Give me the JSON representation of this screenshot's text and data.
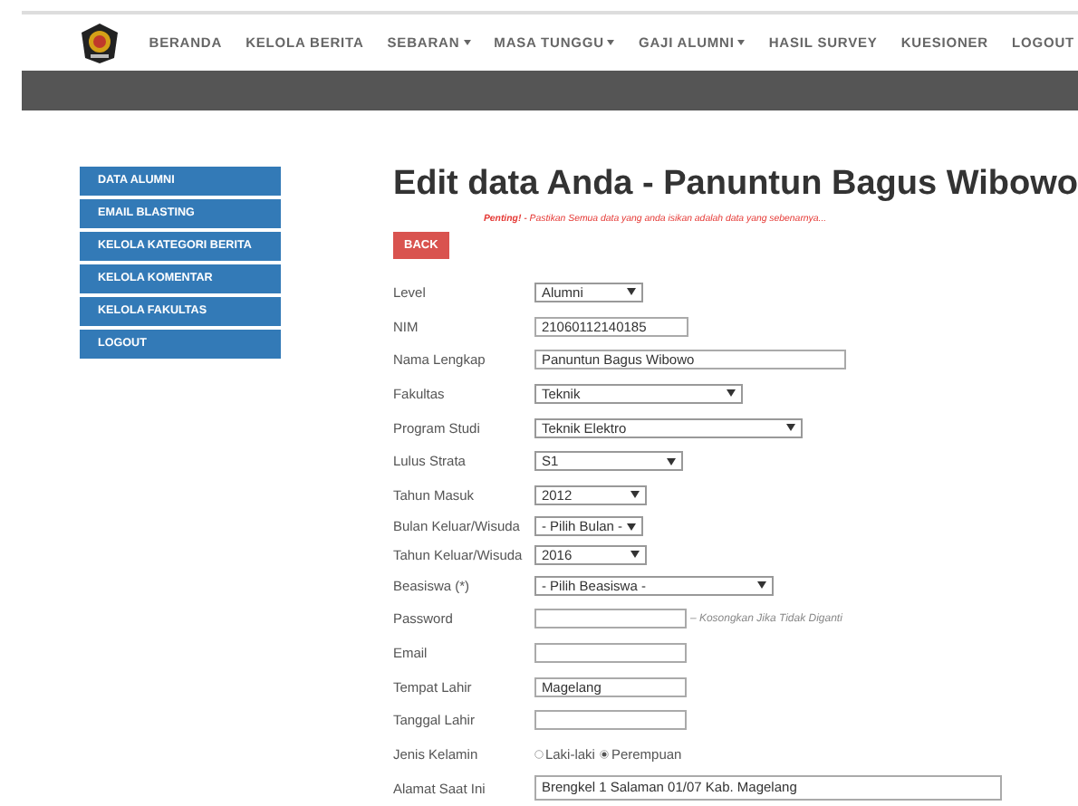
{
  "nav": {
    "items": [
      {
        "label": "BERANDA",
        "dropdown": false
      },
      {
        "label": "KELOLA BERITA",
        "dropdown": false
      },
      {
        "label": "SEBARAN",
        "dropdown": true
      },
      {
        "label": "MASA TUNGGU",
        "dropdown": true
      },
      {
        "label": "GAJI ALUMNI",
        "dropdown": true
      },
      {
        "label": "HASIL SURVEY",
        "dropdown": false
      },
      {
        "label": "KUESIONER",
        "dropdown": false
      },
      {
        "label": "LOGOUT",
        "dropdown": false
      }
    ]
  },
  "sidebar": {
    "items": [
      "DATA ALUMNI",
      "EMAIL BLASTING",
      "KELOLA KATEGORI BERITA",
      "KELOLA KOMENTAR",
      "KELOLA FAKULTAS",
      "LOGOUT"
    ]
  },
  "title": "Edit data Anda - Panuntun Bagus Wibowo",
  "notice": "**Penting!** - Pastikan Semua data yang anda isikan adalah data yang sebenarnya...",
  "back_button": "BACK",
  "form": [
    {
      "label": "Level",
      "kind": "select",
      "value": "Alumni"
    },
    {
      "label": "NIM",
      "kind": "text",
      "value": "21060112140185"
    },
    {
      "label": "Nama Lengkap",
      "kind": "text",
      "value": "Panuntun Bagus Wibowo"
    },
    {
      "label": "Fakultas",
      "kind": "select",
      "value": "Teknik"
    },
    {
      "label": "Program Studi",
      "kind": "select",
      "value": "Teknik Elektro"
    },
    {
      "label": "Lulus Strata",
      "kind": "select",
      "value": "S1"
    },
    {
      "label": "Tahun Masuk",
      "kind": "select",
      "value": "2012"
    },
    {
      "label": "Bulan Keluar/Wisuda",
      "kind": "select",
      "value": "- Pilih Bulan -"
    },
    {
      "label": "Tahun Keluar/Wisuda",
      "kind": "select",
      "value": "2016"
    },
    {
      "label": "Beasiswa (*)",
      "kind": "select",
      "value": "- Pilih Beasiswa -"
    },
    {
      "label": "Password",
      "kind": "text",
      "hint": "– Kosongkan Jika Tidak Diganti"
    },
    {
      "label": "Email",
      "kind": "text"
    },
    {
      "label": "Tempat Lahir",
      "kind": "text",
      "value": "Magelang"
    },
    {
      "label": "Tanggal Lahir",
      "kind": "text"
    },
    {
      "label": "Jenis Kelamin",
      "kind": "radio",
      "options": [
        {
          "label": "Laki-laki",
          "selected": false
        },
        {
          "label": "Perempuan",
          "selected": true
        }
      ]
    },
    {
      "label": "Alamat Saat Ini",
      "kind": "textarea",
      "value": "Brengkel 1 Salaman 01/07 Kab. Magelang"
    }
  ]
}
